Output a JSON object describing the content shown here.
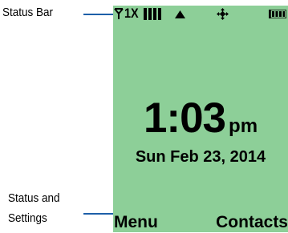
{
  "callouts": {
    "status_bar": "Status Bar",
    "status_settings_line1": "Status and",
    "status_settings_line2": "Settings"
  },
  "status_bar": {
    "signal_label": "1X",
    "icons": [
      "signal-strength-icon",
      "1x-network-icon",
      "signal-bars-icon",
      "data-activity-icon",
      "location-icon",
      "battery-icon"
    ]
  },
  "clock": {
    "time": "1:03",
    "ampm": "pm"
  },
  "date": "Sun Feb 23, 2014",
  "softkeys": {
    "left": "Menu",
    "right": "Contacts"
  },
  "colors": {
    "screen": "#8dcf98",
    "callout_line": "#1d5fa8",
    "text": "#000000"
  }
}
